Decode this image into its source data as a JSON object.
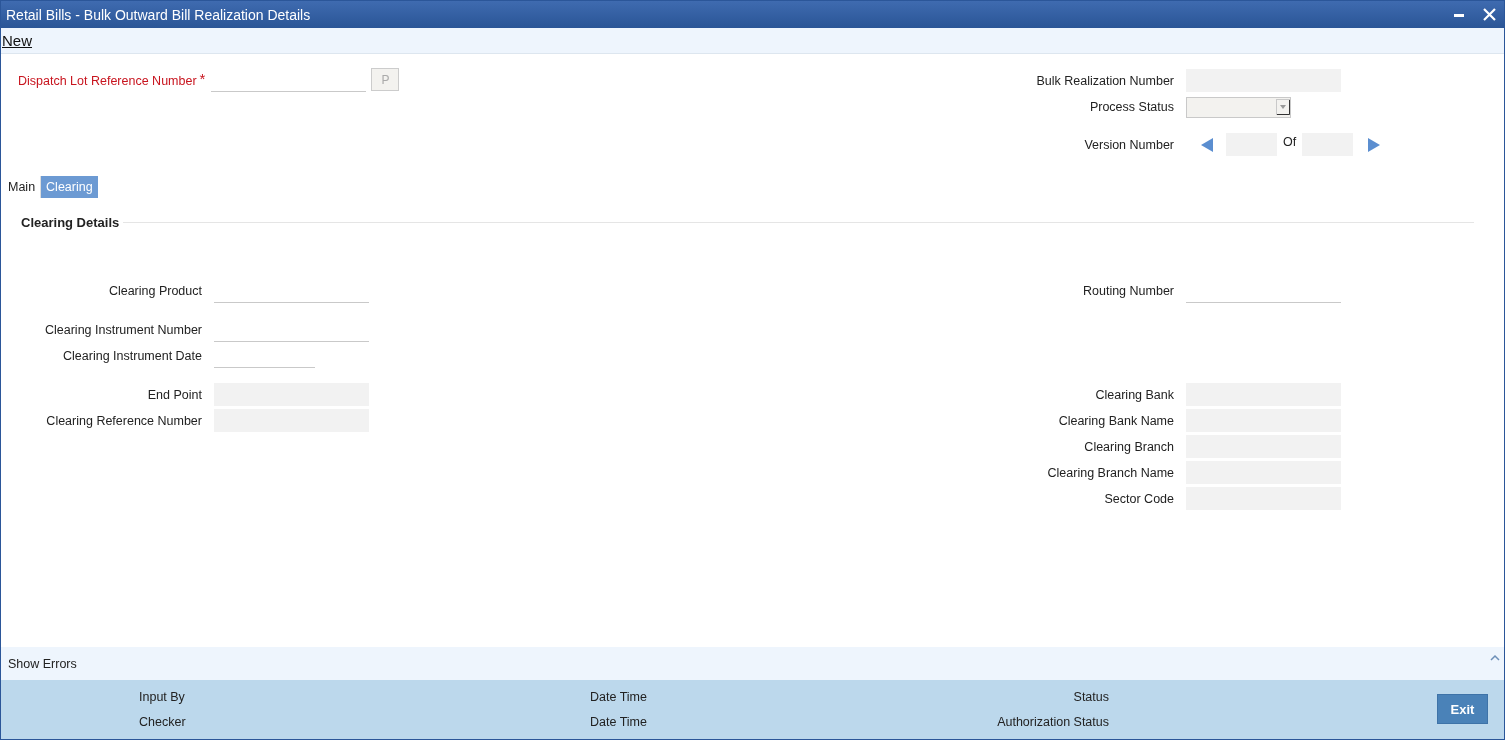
{
  "window": {
    "title": "Retail Bills - Bulk Outward Bill Realization Details"
  },
  "toolbar": {
    "link": "New"
  },
  "dispatch": {
    "label": "Dispatch Lot Reference Number",
    "required": true,
    "required_mark": "*",
    "button": "P"
  },
  "bulk_realization": {
    "label": "Bulk Realization Number"
  },
  "process_status": {
    "label": "Process Status"
  },
  "version": {
    "label": "Version Number",
    "of": "Of"
  },
  "tabs": [
    {
      "label": "Main",
      "selected": false
    },
    {
      "label": "Clearing",
      "selected": true
    }
  ],
  "section": {
    "title": "Clearing Details"
  },
  "row_groups": [
    [
      {
        "left": {
          "label": "Clearing Product",
          "kind": "line"
        },
        "right": {
          "label": "Routing Number",
          "kind": "line"
        }
      }
    ],
    [
      {
        "left": {
          "label": "Clearing Instrument Number",
          "kind": "line"
        }
      },
      {
        "left": {
          "label": "Clearing Instrument Date",
          "kind": "date"
        }
      }
    ],
    [
      {
        "left": {
          "label": "End Point",
          "kind": "filled"
        },
        "right": {
          "label": "Clearing Bank",
          "kind": "filled"
        }
      },
      {
        "left": {
          "label": "Clearing Reference Number",
          "kind": "filled"
        },
        "right": {
          "label": "Clearing Bank Name",
          "kind": "filled"
        }
      },
      {
        "right": {
          "label": "Clearing Branch",
          "kind": "filled"
        }
      },
      {
        "right": {
          "label": "Clearing Branch Name",
          "kind": "filled"
        }
      },
      {
        "right": {
          "label": "Sector Code",
          "kind": "filled"
        }
      }
    ]
  ],
  "show_errors": {
    "label": "Show Errors"
  },
  "audit": [
    [
      "Input By",
      "Date Time",
      "Status"
    ],
    [
      "Checker",
      "Date Time",
      "Authorization Status"
    ]
  ],
  "exit_button": "Exit"
}
